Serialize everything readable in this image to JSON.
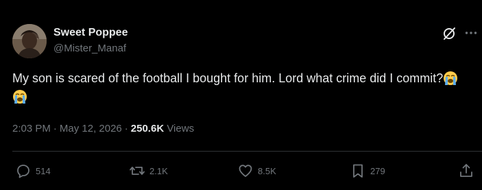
{
  "author": {
    "name": "Sweet Poppee",
    "handle": "@Mister_Manaf"
  },
  "tweet": {
    "text": "My son is scared of the football I bought for him. Lord what crime did I commit?",
    "emojis": [
      "loudly-crying-face",
      "loudly-crying-face"
    ]
  },
  "meta": {
    "time": "2:03 PM",
    "date": "May 12, 2026",
    "views_count": "250.6K",
    "views_label": "Views"
  },
  "actions": {
    "replies": "514",
    "reposts": "2.1K",
    "likes": "8.5K",
    "bookmarks": "279"
  },
  "icons": {
    "top_right": [
      "grok-icon",
      "more-icon"
    ],
    "actions": [
      "reply-icon",
      "repost-icon",
      "like-icon",
      "bookmark-icon",
      "share-icon"
    ]
  },
  "colors": {
    "background": "#000000",
    "primary_text": "#e7e9ea",
    "secondary_text": "#71767b",
    "divider": "#2f3336"
  }
}
